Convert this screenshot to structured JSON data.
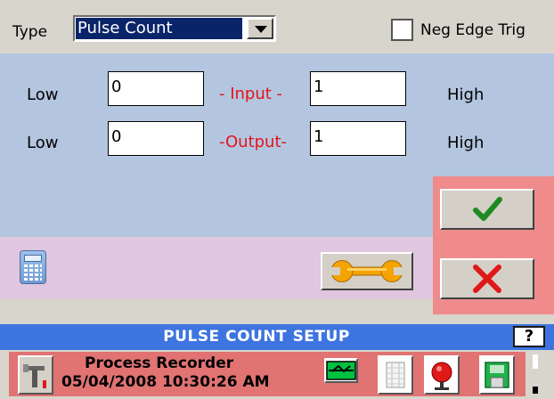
{
  "header": {
    "type_label": "Type",
    "type_value": "Pulse Count",
    "neg_edge_label": "Neg Edge Trig",
    "neg_edge_checked": false
  },
  "input_row": {
    "low_label": "Low",
    "low_value": "0",
    "center_label": "- Input -",
    "high_value": "1",
    "high_label": "High"
  },
  "output_row": {
    "low_label": "Low",
    "low_value": "0",
    "center_label": "-Output-",
    "high_value": "1",
    "high_label": "High"
  },
  "title_bar": {
    "title": "PULSE COUNT SETUP",
    "help_label": "?"
  },
  "status_bar": {
    "app_name": "Process Recorder",
    "datetime": "05/04/2008 10:30:26 AM"
  },
  "icons": {
    "calculator": "calculator-icon",
    "wrench": "wrench-icon",
    "ok": "checkmark-icon",
    "cancel": "x-icon",
    "tools": "tools-icon",
    "network": "network-icon",
    "list": "list-icon",
    "alarm": "alarm-bell-icon",
    "save": "save-disk-icon"
  },
  "colors": {
    "main_panel": "#b4c6df",
    "tools_panel": "#e0c6df",
    "action_panel": "#ef8b8b",
    "title_bar": "#3d74e0",
    "status_bar": "#e17373",
    "accent_text": "#e4141c"
  }
}
